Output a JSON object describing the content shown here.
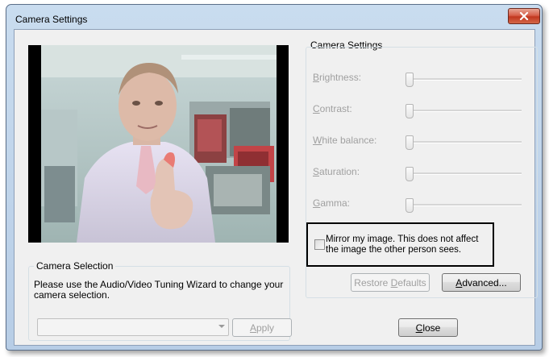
{
  "window": {
    "title": "Camera Settings"
  },
  "camera_settings": {
    "legend": "Camera Settings",
    "sliders": [
      {
        "key": "brightness",
        "label": "Brightness:",
        "accel": "B",
        "rest": "rightness:",
        "value": 0
      },
      {
        "key": "contrast",
        "label": "Contrast:",
        "accel": "C",
        "rest": "ontrast:",
        "value": 0
      },
      {
        "key": "white_balance",
        "label": "White balance:",
        "accel": "W",
        "rest": "hite balance:",
        "value": 0
      },
      {
        "key": "saturation",
        "label": "Saturation:",
        "accel": "S",
        "rest": "aturation:",
        "value": 0
      },
      {
        "key": "gamma",
        "label": "Gamma:",
        "accel": "G",
        "rest": "amma:",
        "value": 0
      }
    ],
    "mirror": {
      "checked": false,
      "text": "Mirror my image.  This does not affect the image the other person sees."
    },
    "restore_defaults": {
      "label": "Restore Defaults",
      "pre": "Restore ",
      "accel": "D",
      "post": "efaults"
    },
    "advanced": {
      "label": "Advanced...",
      "accel": "A",
      "post": "dvanced..."
    }
  },
  "camera_selection": {
    "legend": "Camera Selection",
    "text": "Please use the Audio/Video Tuning Wizard to change your camera selection.",
    "dropdown_value": "",
    "apply": {
      "label": "Apply",
      "accel": "A",
      "post": "pply"
    }
  },
  "close": {
    "label": "Close",
    "accel": "C",
    "post": "lose"
  },
  "colors": {
    "frame": "#b7cde6",
    "client": "#f0f0f0",
    "close_button": "#c1371f",
    "disabled_text": "#a0a0a0"
  }
}
